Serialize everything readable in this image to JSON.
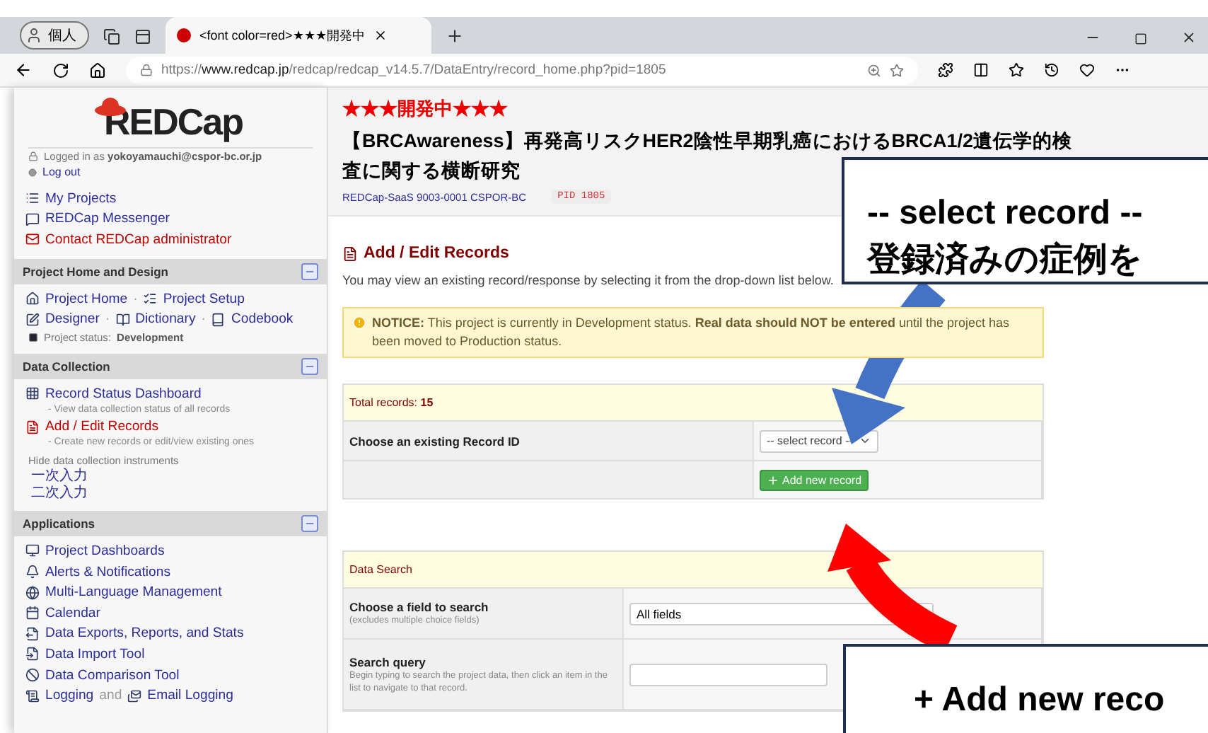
{
  "browser": {
    "profile": "個人",
    "tab_title": "<font color=red>★★★開発中",
    "url_scheme": "https://",
    "url_host": "www.redcap.jp",
    "url_path": "/redcap/redcap_v14.5.7/DataEntry/record_home.php?pid=1805"
  },
  "sidebar": {
    "logo": "REDCap",
    "login_label": "Logged in as",
    "user": "yokoyamauchi@cspor-bc.or.jp",
    "logout": "Log out",
    "links": [
      {
        "label": "My Projects",
        "kind": "normal"
      },
      {
        "label": "REDCap Messenger",
        "kind": "normal"
      },
      {
        "label": "Contact REDCap administrator",
        "kind": "alert"
      }
    ],
    "design": {
      "title": "Project Home and Design",
      "separator": "·",
      "rows": [
        [
          "Project Home",
          "Project Setup"
        ],
        [
          "Designer",
          "Dictionary",
          "Codebook"
        ]
      ],
      "status_label": "Project status:",
      "status": "Development"
    },
    "collection": {
      "title": "Data Collection",
      "items": [
        {
          "label": "Record Status Dashboard",
          "note": "- View data collection status of all records",
          "selected": false
        },
        {
          "label": "Add / Edit Records",
          "note": "- Create new records or edit/view existing ones",
          "selected": true
        }
      ],
      "hide_label": "Hide data collection instruments",
      "instruments": [
        "一次入力",
        "二次入力"
      ]
    },
    "applications": {
      "title": "Applications",
      "items": [
        "Project Dashboards",
        "Alerts & Notifications",
        "Multi-Language Management",
        "Calendar",
        "Data Exports, Reports, and Stats",
        "Data Import Tool",
        "Data Comparison Tool"
      ],
      "logging": {
        "first": "Logging",
        "joiner": "and",
        "second": "Email Logging"
      }
    }
  },
  "header": {
    "badge": "★★★開発中★★★",
    "title": "【BRCAwareness】再発高リスクHER2陰性早期乳癌におけるBRCA1/2遺伝学的検査に関する横断研究",
    "subtitle": "REDCap-SaaS 9003-0001 CSPOR-BC",
    "pid": "PID 1805"
  },
  "page": {
    "heading": "Add / Edit Records",
    "intro": "You may view an existing record/response by selecting it from the drop-down list below.",
    "notice": "**NOTICE:** This project is currently in Development status. **Real data should NOT be entered** until the project has been moved to Production status."
  },
  "records": {
    "total_label": "Total records:",
    "total": "15",
    "choose_label": "Choose an existing Record ID",
    "select_placeholder": "-- select record --",
    "add_button": "Add new record"
  },
  "search": {
    "title": "Data Search",
    "field_label": "Choose a field to search",
    "field_note": "(excludes multiple choice fields)",
    "field_value": "All fields",
    "query_label": "Search query",
    "query_note": "Begin typing to search the project data, then click an item in the list to navigate to that record."
  },
  "callouts": [
    {
      "lines": [
        "-- select record --",
        "登録済みの症例を"
      ],
      "color": "#4472c4"
    },
    {
      "lines": [
        "+ Add new reco"
      ],
      "color": "#ff0000"
    }
  ]
}
